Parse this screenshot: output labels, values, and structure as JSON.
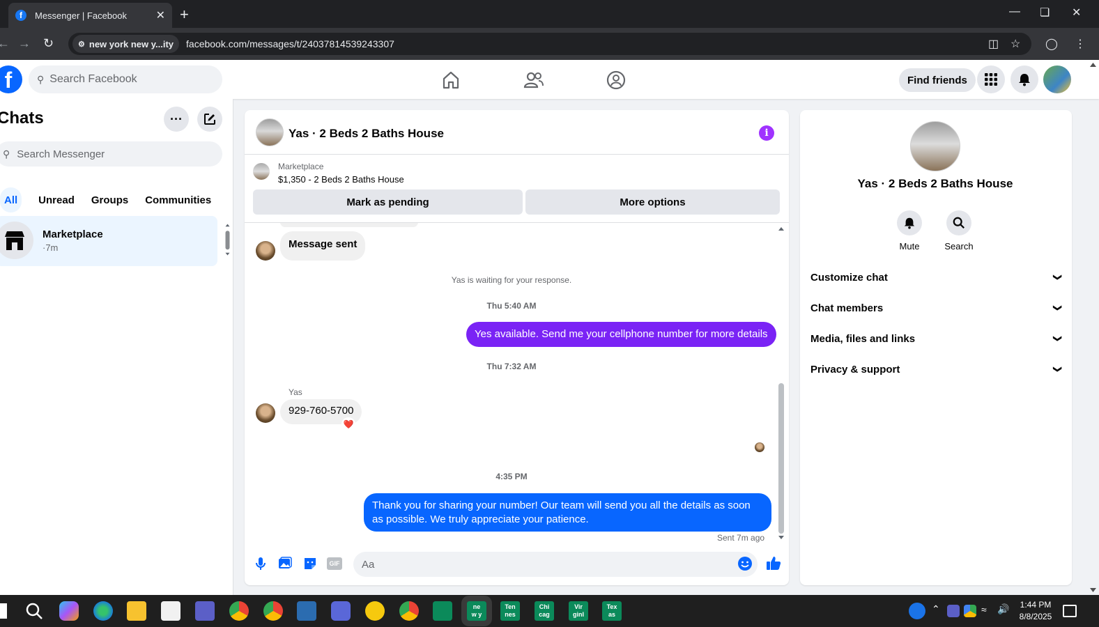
{
  "browser": {
    "tab_title": "Messenger | Facebook",
    "tab_close": "✕",
    "new_tab": "+",
    "site_chip": "new york new y...ity",
    "url": "facebook.com/messages/t/24037814539243307"
  },
  "fb": {
    "search_placeholder": "Search Facebook",
    "find_friends": "Find friends"
  },
  "chats": {
    "title": "Chats",
    "search_placeholder": "Search Messenger",
    "filters": [
      "All",
      "Unread",
      "Groups",
      "Communities"
    ],
    "items": [
      {
        "name": "Marketplace",
        "sub": "·7m"
      }
    ]
  },
  "conversation": {
    "title": "Yas · 2 Beds 2 Baths House",
    "marketplace_label": "Marketplace",
    "listing": "$1,350 - 2 Beds 2 Baths House",
    "mark_pending": "Mark as pending",
    "more_options": "More options",
    "messages": {
      "msg1": "Message sent",
      "waiting": "Yas is waiting for your response.",
      "ts1": "Thu 5:40 AM",
      "out1": "Yes available. Send me your cellphone number for more details",
      "ts2": "Thu 7:32 AM",
      "sender": "Yas",
      "phone": "929-760-5700",
      "reaction": "❤️",
      "ts3": "4:35 PM",
      "out2": "Thank you for sharing your number! Our team will send you all the details as soon as possible. We truly appreciate your patience.",
      "sent_status": "Sent 7m ago"
    },
    "composer_placeholder": "Aa",
    "gif_label": "GIF",
    "colors": {
      "purple": "#7a23f5",
      "blue": "#0866ff"
    }
  },
  "info_panel": {
    "name": "Yas · 2 Beds 2 Baths House",
    "actions": [
      "Mute",
      "Search"
    ],
    "rows": [
      "Customize chat",
      "Chat members",
      "Media, files and links",
      "Privacy & support"
    ]
  },
  "taskbar": {
    "time": "1:44 PM",
    "date": "8/8/2025",
    "app_labels": [
      "ne\nw y",
      "Ten\nnes",
      "Chi\ncag",
      "Vir\nginI",
      "Tex\nas"
    ]
  }
}
